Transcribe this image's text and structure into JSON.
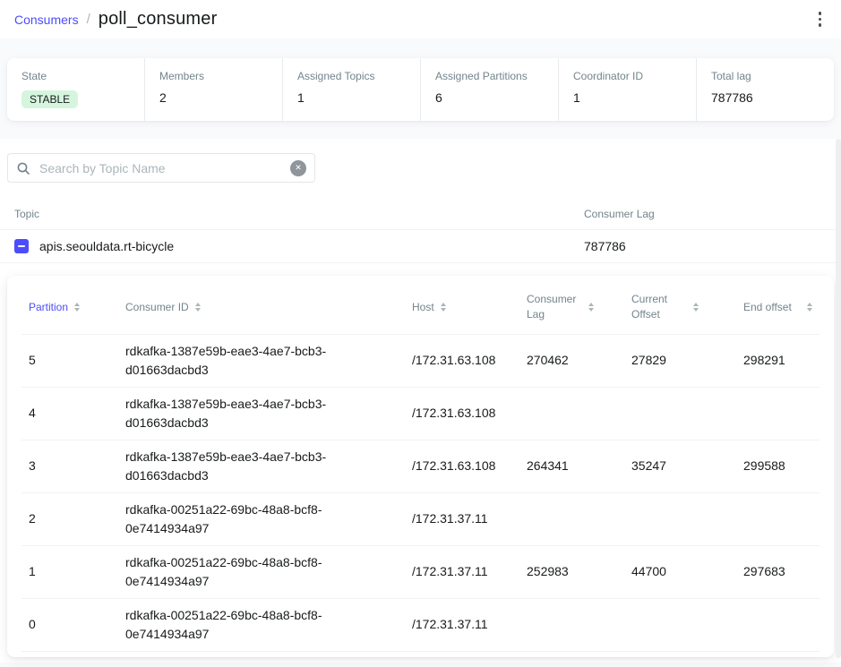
{
  "breadcrumb": {
    "parent": "Consumers",
    "separator": "/",
    "current": "poll_consumer"
  },
  "metrics": [
    {
      "label": "State",
      "value": "STABLE"
    },
    {
      "label": "Members",
      "value": "2"
    },
    {
      "label": "Assigned Topics",
      "value": "1"
    },
    {
      "label": "Assigned Partitions",
      "value": "6"
    },
    {
      "label": "Coordinator ID",
      "value": "1"
    },
    {
      "label": "Total lag",
      "value": "787786"
    }
  ],
  "search": {
    "placeholder": "Search by Topic Name",
    "value": ""
  },
  "icons": {
    "clear_glyph": "✕"
  },
  "topics_table": {
    "columns": [
      "Topic",
      "Consumer Lag"
    ],
    "rows": [
      {
        "topic": "apis.seouldata.rt-bicycle",
        "consumer_lag": "787786"
      }
    ]
  },
  "partitions_table": {
    "columns": [
      "Partition",
      "Consumer ID",
      "Host",
      "Consumer Lag",
      "Current Offset",
      "End offset"
    ],
    "rows": [
      {
        "partition": "5",
        "consumer_id": "rdkafka-1387e59b-eae3-4ae7-bcb3-d01663dacbd3",
        "host": "/172.31.63.108",
        "consumer_lag": "270462",
        "current_offset": "27829",
        "end_offset": "298291"
      },
      {
        "partition": "4",
        "consumer_id": "rdkafka-1387e59b-eae3-4ae7-bcb3-d01663dacbd3",
        "host": "/172.31.63.108",
        "consumer_lag": "",
        "current_offset": "",
        "end_offset": ""
      },
      {
        "partition": "3",
        "consumer_id": "rdkafka-1387e59b-eae3-4ae7-bcb3-d01663dacbd3",
        "host": "/172.31.63.108",
        "consumer_lag": "264341",
        "current_offset": "35247",
        "end_offset": "299588"
      },
      {
        "partition": "2",
        "consumer_id": "rdkafka-00251a22-69bc-48a8-bcf8-0e7414934a97",
        "host": "/172.31.37.11",
        "consumer_lag": "",
        "current_offset": "",
        "end_offset": ""
      },
      {
        "partition": "1",
        "consumer_id": "rdkafka-00251a22-69bc-48a8-bcf8-0e7414934a97",
        "host": "/172.31.37.11",
        "consumer_lag": "252983",
        "current_offset": "44700",
        "end_offset": "297683"
      },
      {
        "partition": "0",
        "consumer_id": "rdkafka-00251a22-69bc-48a8-bcf8-0e7414934a97",
        "host": "/172.31.37.11",
        "consumer_lag": "",
        "current_offset": "",
        "end_offset": ""
      }
    ]
  },
  "colors": {
    "accent": "#4c4cff",
    "badge_success_bg": "#d6f5de",
    "text_primary": "#171a1c",
    "text_secondary": "#73848c",
    "border": "#e3e6e8",
    "page_bg": "#f9fafb"
  }
}
